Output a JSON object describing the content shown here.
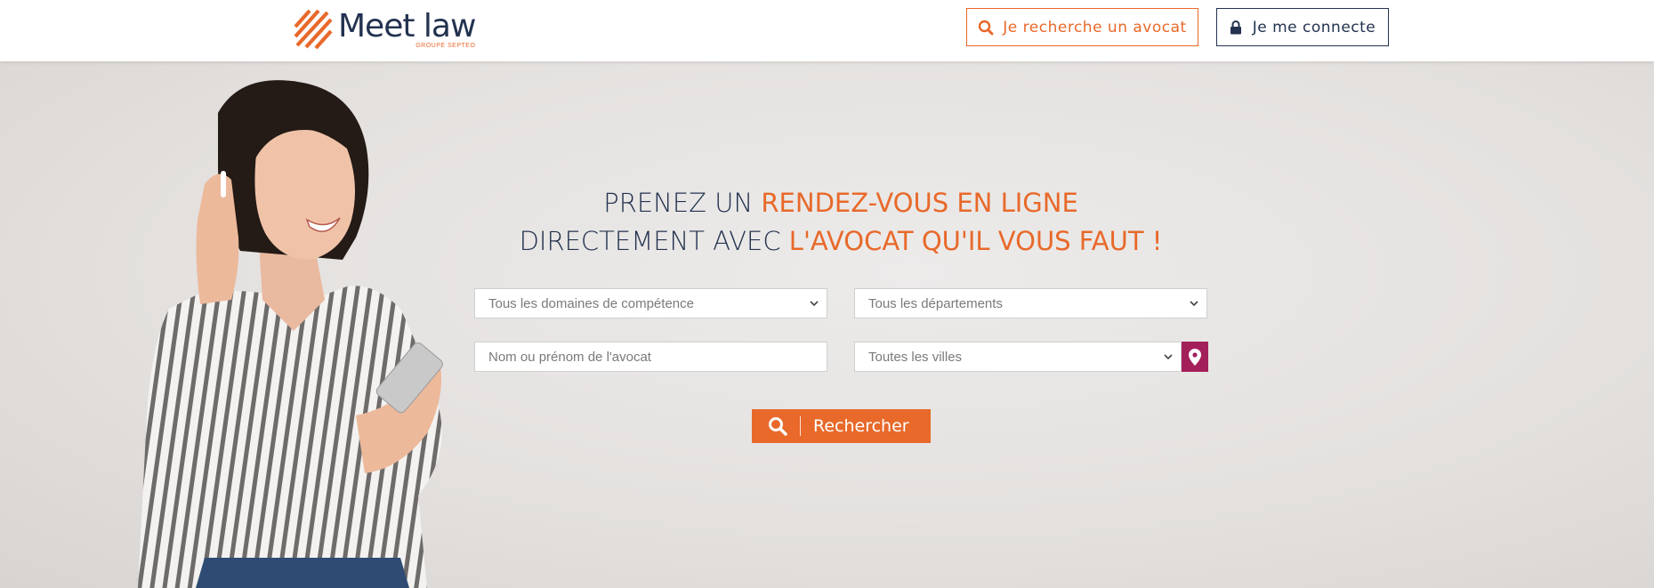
{
  "header": {
    "logo_text": "Meet law",
    "logo_subtext": "GROUPE SEPTEO",
    "find_lawyer_label": "Je recherche un avocat",
    "login_label": "Je me connecte"
  },
  "hero": {
    "headline_line1_plain": "PRENEZ UN ",
    "headline_line1_accent": "RENDEZ-VOUS EN LIGNE",
    "headline_line2_plain": "DIRECTEMENT AVEC ",
    "headline_line2_accent": "L'AVOCAT QU'IL VOUS FAUT !"
  },
  "search_form": {
    "domaines_selected": "Tous les domaines de compétence",
    "departements_selected": "Tous les départements",
    "nom_placeholder": "Nom ou prénom de l'avocat",
    "villes_selected": "Toutes les villes",
    "submit_label": "Rechercher"
  },
  "colors": {
    "brand_orange": "#e8692a",
    "brand_navy": "#23324f",
    "geo_button": "#a31f5a"
  },
  "icons": {
    "find_lawyer": "search-icon",
    "login": "lock-icon",
    "geo": "map-pin-icon",
    "submit": "search-icon"
  }
}
